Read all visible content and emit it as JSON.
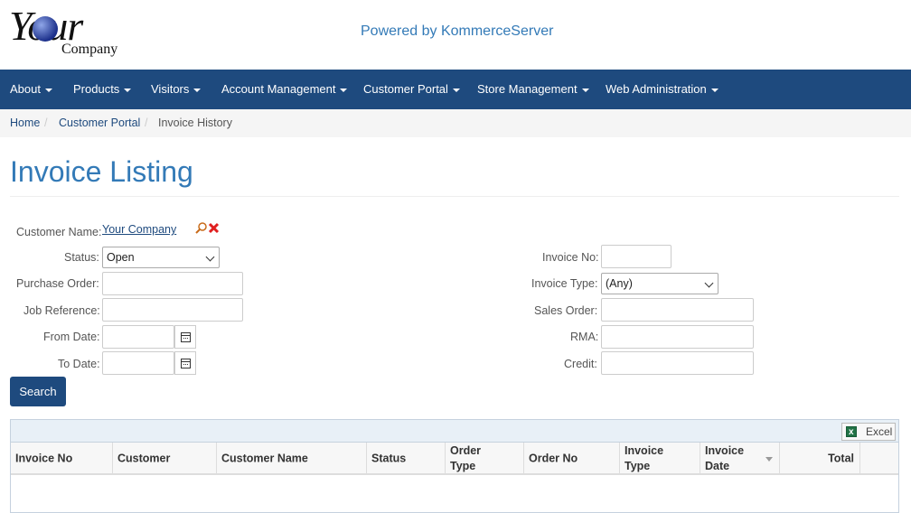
{
  "header": {
    "logo_main": "Your",
    "logo_sub": "Company",
    "powered_by": "Powered by KommerceServer"
  },
  "nav": {
    "items": [
      "About",
      "Products",
      "Visitors",
      "Account Management",
      "Customer Portal",
      "Store Management",
      "Web Administration"
    ]
  },
  "breadcrumb": {
    "home": "Home",
    "portal": "Customer Portal",
    "current": "Invoice History",
    "separator": "/"
  },
  "page": {
    "title": "Invoice Listing"
  },
  "form": {
    "customer_name_label": "Customer Name:",
    "customer_name_value": "Your Company",
    "status_label": "Status:",
    "status_value": "Open",
    "purchase_order_label": "Purchase Order:",
    "job_reference_label": "Job Reference:",
    "from_date_label": "From Date:",
    "to_date_label": "To Date:",
    "invoice_no_label": "Invoice No:",
    "invoice_type_label": "Invoice Type:",
    "invoice_type_value": "(Any)",
    "sales_order_label": "Sales Order:",
    "rma_label": "RMA:",
    "credit_label": "Credit:",
    "search_button": "Search"
  },
  "grid": {
    "excel_label": "Excel",
    "columns": [
      "Invoice No",
      "Customer",
      "Customer Name",
      "Status",
      "Order Type",
      "Order No",
      "Invoice Type",
      "Invoice Date",
      "Total"
    ]
  },
  "colors": {
    "navbar": "#1e4a7e",
    "title": "#337ab7",
    "link": "#1e4a7e"
  }
}
